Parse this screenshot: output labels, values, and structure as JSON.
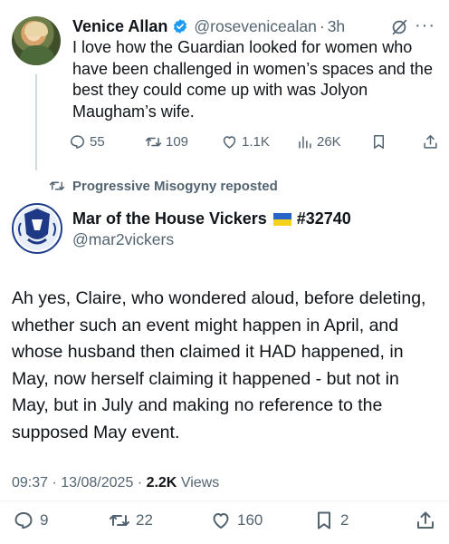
{
  "tweet1": {
    "name": "Venice Allan",
    "handle": "@rosevenicealan",
    "time": "3h",
    "text": "I love how the Guardian looked for women who have been challenged in women’s spaces and the best they could come up with was Jolyon Maugham’s wife.",
    "replies": "55",
    "reposts": "109",
    "likes": "1.1K",
    "views": "26K",
    "icons": {
      "verified": "verified-badge-icon",
      "grok": "grok-icon",
      "more": "more-icon"
    }
  },
  "repost_banner": {
    "label": "Progressive Misogyny reposted"
  },
  "tweet2": {
    "name": "Mar of the House Vickers",
    "tag": "#32740",
    "handle": "@mar2vickers",
    "text": "Ah yes, Claire, who wondered aloud, before deleting, whether such an event might happen in April, and whose husband then claimed it HAD happened, in May, now herself claiming it happened - but not in May, but in July and making no reference to the supposed May event.",
    "time_date": "09:37 · 13/08/2025 ·",
    "views_count": "2.2K",
    "views_label": "Views",
    "replies": "9",
    "reposts": "22",
    "likes": "160",
    "bookmarks": "2"
  },
  "colors": {
    "text": "#0f1419",
    "muted": "#536471",
    "verified_blue": "#1d9bf0",
    "flag_blue": "#2a64c8",
    "flag_yellow": "#f4d21c"
  }
}
